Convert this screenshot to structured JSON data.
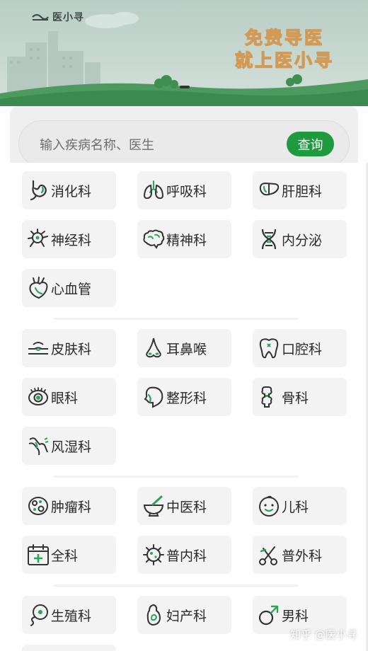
{
  "banner": {
    "brand": "医小寻",
    "slogan_line1": "免费导医",
    "slogan_line2": "就上医小寻"
  },
  "search": {
    "placeholder": "输入疾病名称、医生",
    "button": "查询"
  },
  "departments": [
    {
      "label": "消化科",
      "icon": "stomach-icon"
    },
    {
      "label": "呼吸科",
      "icon": "lungs-icon"
    },
    {
      "label": "肝胆科",
      "icon": "liver-icon"
    },
    {
      "label": "神经科",
      "icon": "neuron-icon"
    },
    {
      "label": "精神科",
      "icon": "brain-icon"
    },
    {
      "label": "内分泌",
      "icon": "dna-icon"
    },
    {
      "label": "心血管",
      "icon": "heart-icon"
    },
    {
      "label": "皮肤科",
      "icon": "skin-icon"
    },
    {
      "label": "耳鼻喉",
      "icon": "nose-icon"
    },
    {
      "label": "口腔科",
      "icon": "tooth-icon"
    },
    {
      "label": "眼科",
      "icon": "eye-icon"
    },
    {
      "label": "整形科",
      "icon": "face-profile-icon"
    },
    {
      "label": "骨科",
      "icon": "bone-icon"
    },
    {
      "label": "风湿科",
      "icon": "joint-icon"
    },
    {
      "label": "肿瘤科",
      "icon": "tumor-cell-icon"
    },
    {
      "label": "中医科",
      "icon": "mortar-icon"
    },
    {
      "label": "儿科",
      "icon": "baby-face-icon"
    },
    {
      "label": "全科",
      "icon": "calendar-plus-icon"
    },
    {
      "label": "普内科",
      "icon": "virus-icon"
    },
    {
      "label": "普外科",
      "icon": "scissors-icon"
    },
    {
      "label": "生殖科",
      "icon": "sperm-icon"
    },
    {
      "label": "妇产科",
      "icon": "pregnant-icon"
    },
    {
      "label": "男科",
      "icon": "male-symbol-icon"
    }
  ],
  "watermark": "知乎 @医小寻",
  "colors": {
    "accent": "#1f9b3f",
    "icon_stroke": "#333333",
    "icon_green": "#2aa55a"
  }
}
